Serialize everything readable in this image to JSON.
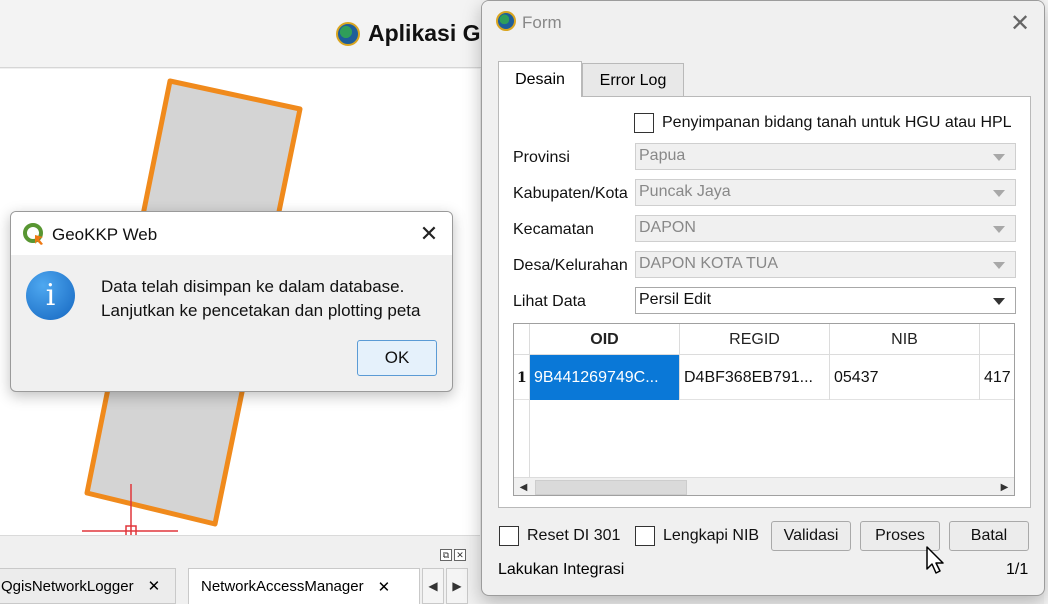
{
  "main_window": {
    "title": "Aplikasi G"
  },
  "bottom_dock": {
    "tabs": [
      {
        "label": "QgisNetworkLogger"
      },
      {
        "label": "NetworkAccessManager"
      }
    ]
  },
  "message_box": {
    "title": "GeoKKP Web",
    "line1": "Data telah disimpan ke dalam database.",
    "line2": "Lanjutkan ke pencetakan dan plotting peta",
    "ok_label": "OK"
  },
  "form": {
    "title": "Form",
    "tabs": [
      {
        "label": "Desain",
        "active": true
      },
      {
        "label": "Error Log",
        "active": false
      }
    ],
    "hgu_checkbox_label": "Penyimpanan bidang tanah untuk HGU atau HPL",
    "fields": {
      "provinsi": {
        "label": "Provinsi",
        "value": "Papua"
      },
      "kabupaten": {
        "label": "Kabupaten/Kota",
        "value": "Puncak Jaya"
      },
      "kecamatan": {
        "label": "Kecamatan",
        "value": "DAPON"
      },
      "desa": {
        "label": "Desa/Kelurahan",
        "value": "DAPON KOTA TUA"
      },
      "lihat_data": {
        "label": "Lihat Data",
        "value": "Persil Edit"
      }
    },
    "table": {
      "columns": [
        "OID",
        "REGID",
        "NIB",
        ""
      ],
      "rows": [
        {
          "num": "1",
          "oid": "9B441269749C...",
          "regid": "D4BF368EB791...",
          "nib": "05437",
          "extra": "417"
        }
      ]
    },
    "reset_label": "Reset DI 301",
    "lengkapi_label": "Lengkapi NIB",
    "buttons": {
      "validasi": "Validasi",
      "proses": "Proses",
      "batal": "Batal"
    },
    "status_text": "Lakukan Integrasi",
    "page_indicator": "1/1"
  },
  "colors": {
    "selection": "#0a78d7",
    "polygon_outline": "#f08a1c",
    "info_icon": "#1566c0"
  }
}
